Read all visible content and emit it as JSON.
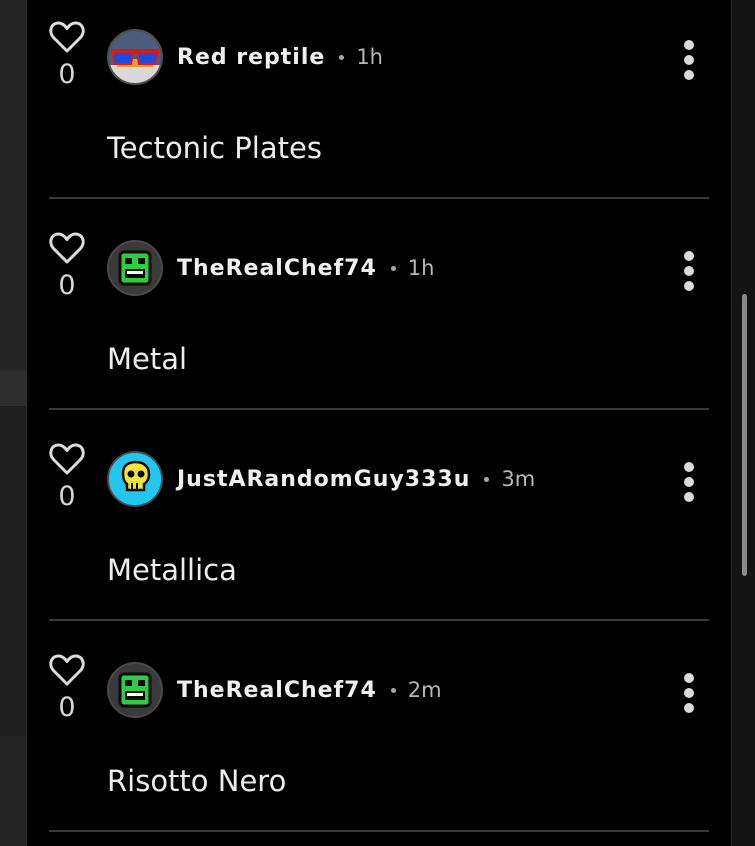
{
  "comments": [
    {
      "likes": "0",
      "username": "Red reptile",
      "time": "1h",
      "text": "Tectonic Plates",
      "avatar_icon": "sunglasses-face-icon"
    },
    {
      "likes": "0",
      "username": "TheRealChef74",
      "time": "1h",
      "text": "Metal",
      "avatar_icon": "green-monster-face-icon"
    },
    {
      "likes": "0",
      "username": "JustARandomGuy333u",
      "time": "3m",
      "text": "Metallica",
      "avatar_icon": "yellow-skull-icon"
    },
    {
      "likes": "0",
      "username": "TheRealChef74",
      "time": "2m",
      "text": "Risotto Nero",
      "avatar_icon": "green-monster-face-icon"
    }
  ],
  "colors": {
    "panel_background": "#000000",
    "text_primary": "#ededed",
    "text_secondary": "#b8b8b8",
    "divider": "#3a3a3a"
  }
}
